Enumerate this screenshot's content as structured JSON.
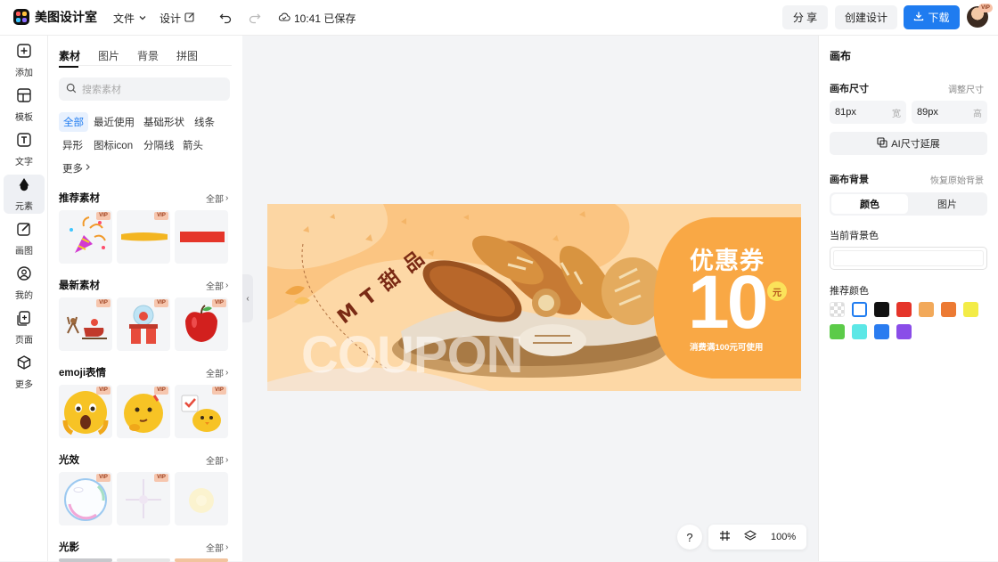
{
  "app": {
    "name": "美图设计室"
  },
  "topbar": {
    "file_menu": "文件",
    "design_menu": "设计",
    "save_status": "10:41 已保存",
    "share_label": "分 享",
    "create_label": "创建设计",
    "download_label": "下载",
    "vip_badge": "VIP"
  },
  "leftnav": {
    "items": [
      {
        "label": "添加",
        "icon": "plus-square-icon"
      },
      {
        "label": "模板",
        "icon": "template-icon"
      },
      {
        "label": "文字",
        "icon": "text-icon"
      },
      {
        "label": "元素",
        "icon": "shapes-icon"
      },
      {
        "label": "画图",
        "icon": "pencil-icon"
      },
      {
        "label": "我的",
        "icon": "user-icon"
      },
      {
        "label": "页面",
        "icon": "page-add-icon"
      },
      {
        "label": "更多",
        "icon": "cube-icon"
      }
    ]
  },
  "panel": {
    "tabs": [
      "素材",
      "图片",
      "背景",
      "拼图"
    ],
    "search_placeholder": "搜索素材",
    "chips": [
      "全部",
      "最近使用",
      "基础形状",
      "线条",
      "异形",
      "图标icon",
      "分隔线",
      "箭头",
      "更多"
    ],
    "all_label": "全部",
    "vip_label": "VIP",
    "sections": [
      "推荐素材",
      "最新素材",
      "emoji表情",
      "光效",
      "光影"
    ]
  },
  "canvas": {
    "coupon_title": "优惠券",
    "amount": "10",
    "unit": "元",
    "condition": "消费满100元可使用",
    "brand": "M T 甜 品",
    "coupon_text": "COUPON"
  },
  "rightpanel": {
    "title": "画布",
    "size_label": "画布尺寸",
    "resize_link": "调整尺寸",
    "width_value": "81px",
    "width_unit": "宽",
    "height_value": "89px",
    "height_unit": "高",
    "ai_extend": "AI尺寸延展",
    "bg_label": "画布背景",
    "restore_link": "恢复原始背景",
    "seg_color": "颜色",
    "seg_image": "图片",
    "current_bg": "当前背景色",
    "recommended": "推荐颜色",
    "swatches": [
      "transparent",
      "#ffffff",
      "#111111",
      "#e5352a",
      "#f2a95a",
      "#ec7a33",
      "#f3ec47",
      "#5ccb49",
      "#5ce7e6",
      "#2a7cf0",
      "#8a4de8"
    ]
  },
  "bottom": {
    "help": "?",
    "zoom": "100%"
  }
}
